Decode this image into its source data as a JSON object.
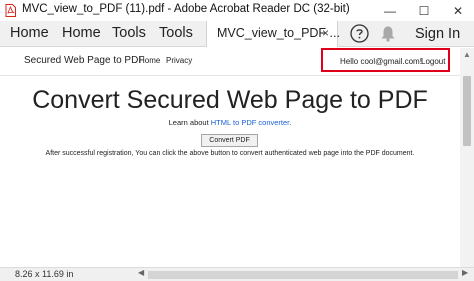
{
  "window": {
    "title": "MVC_view_to_PDF (11).pdf - Adobe Acrobat Reader DC (32-bit)",
    "minimize_glyph": "—",
    "maximize_glyph": "☐",
    "close_glyph": "✕"
  },
  "menubar": {
    "items": [
      "Home",
      "Home",
      "Tools",
      "Tools"
    ],
    "doc_tab": "MVC_view_to_PDF ...",
    "doc_tab_close": "×",
    "sign_in": "Sign In"
  },
  "site": {
    "brand": "Secured Web Page to PDF",
    "nav": [
      "Home",
      "Privacy"
    ],
    "greeting": "Hello cool@gmail.com!",
    "logout": "Logout"
  },
  "content": {
    "headline": "Convert Secured Web Page to PDF",
    "learn_prefix": "Learn about ",
    "learn_link": "HTML to PDF converter",
    "learn_suffix": ".",
    "button": "Convert PDF",
    "note": "After successful registration, You can click the above button to convert authenticated web page into the PDF document."
  },
  "status": {
    "page_size": "8.26 x 11.69 in"
  },
  "colors": {
    "highlight": "#e0001b",
    "link": "#1a5fd6",
    "acrobat_red": "#d7261b"
  },
  "icons": [
    "pdf-file-icon",
    "help-icon",
    "bell-icon",
    "scroll-up-icon",
    "scroll-left-icon",
    "scroll-right-icon"
  ]
}
